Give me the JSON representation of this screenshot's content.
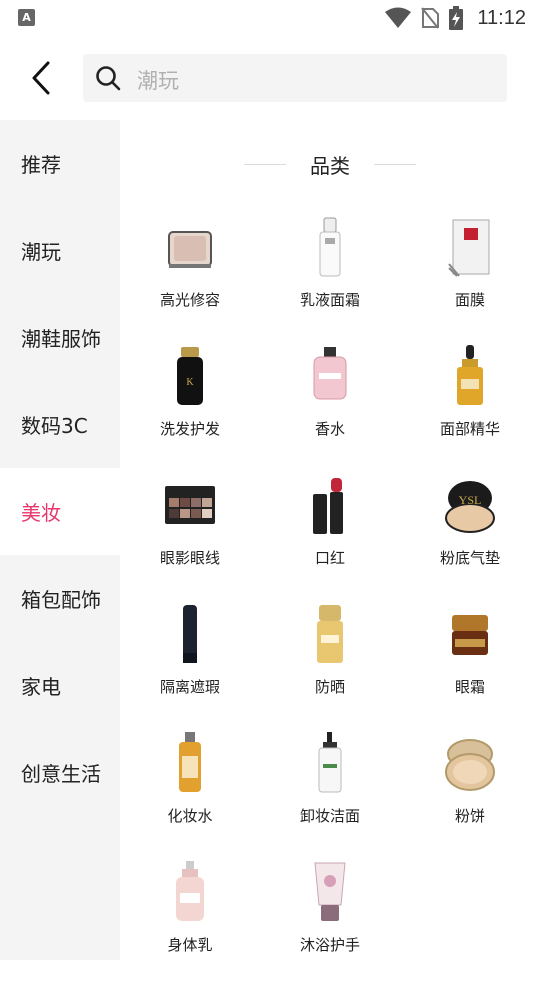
{
  "status_bar": {
    "time": "11:12",
    "app_badge": "A"
  },
  "header": {
    "search_placeholder": "潮玩"
  },
  "sidebar": {
    "items": [
      {
        "label": "推荐"
      },
      {
        "label": "潮玩"
      },
      {
        "label": "潮鞋服饰"
      },
      {
        "label": "数码3C"
      },
      {
        "label": "美妆"
      },
      {
        "label": "箱包配饰"
      },
      {
        "label": "家电"
      },
      {
        "label": "创意生活"
      }
    ],
    "active_index": 4,
    "active_color": "#e8356b"
  },
  "main": {
    "section_title": "品类",
    "categories": [
      {
        "label": "高光修容",
        "icon": "highlighter-compact-icon"
      },
      {
        "label": "乳液面霜",
        "icon": "lotion-bottle-icon"
      },
      {
        "label": "面膜",
        "icon": "face-mask-pack-icon"
      },
      {
        "label": "洗发护发",
        "icon": "shampoo-bottle-icon"
      },
      {
        "label": "香水",
        "icon": "perfume-bottle-icon"
      },
      {
        "label": "面部精华",
        "icon": "serum-dropper-icon"
      },
      {
        "label": "眼影眼线",
        "icon": "eyeshadow-palette-icon"
      },
      {
        "label": "口红",
        "icon": "lipstick-icon"
      },
      {
        "label": "粉底气垫",
        "icon": "cushion-compact-icon"
      },
      {
        "label": "隔离遮瑕",
        "icon": "primer-tube-icon"
      },
      {
        "label": "防晒",
        "icon": "sunscreen-bottle-icon"
      },
      {
        "label": "眼霜",
        "icon": "eye-cream-jar-icon"
      },
      {
        "label": "化妆水",
        "icon": "toner-bottle-icon"
      },
      {
        "label": "卸妆洁面",
        "icon": "cleansing-oil-pump-icon"
      },
      {
        "label": "粉饼",
        "icon": "powder-compact-icon"
      },
      {
        "label": "身体乳",
        "icon": "body-lotion-bottle-icon"
      },
      {
        "label": "沐浴护手",
        "icon": "hand-cream-tube-icon"
      }
    ]
  }
}
